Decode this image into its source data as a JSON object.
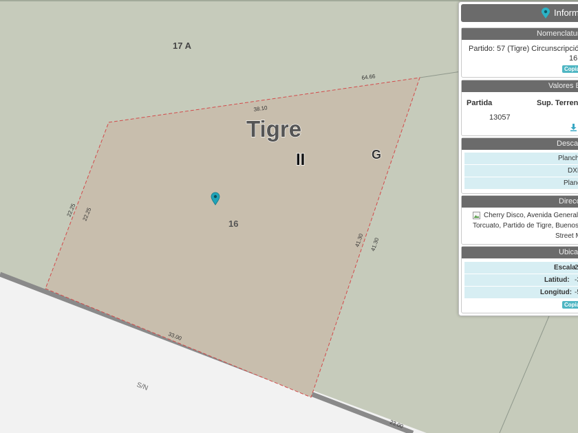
{
  "map": {
    "colors": {
      "land": "#c6cbbb",
      "parcel_fill": "#c8bead",
      "road": "#f2f2f2",
      "boundary": "#d24a4a",
      "road_edge": "#8a8a8a",
      "marker": "#1fa3b8"
    },
    "labels": {
      "block_17a": "17 A",
      "locality": "Tigre",
      "circ": "II",
      "sector": "G",
      "parcel": "16",
      "street": "S/N"
    },
    "dimensions": {
      "d1": "64.66",
      "d2": "38.10",
      "d3": "22.25",
      "d4": "22.25",
      "d5": "41.30",
      "d6": "41.30",
      "d7": "33.00",
      "d8": "23.00"
    }
  },
  "panel": {
    "title": "Inform",
    "nomenclatura": {
      "header": "Nomenclatura",
      "line1": "Partido: 57 (Tigre) Circunscripción: 2",
      "line2": "16",
      "copy": "Copia"
    },
    "valores": {
      "header": "Valores B",
      "col_partida": "Partida",
      "col_sup": "Sup. Terreno",
      "partida_value": "13057"
    },
    "descargas": {
      "header": "Descar",
      "items": [
        "Planch",
        "DXF",
        "Planc"
      ]
    },
    "direccion": {
      "header": "Direcc",
      "line1": "Cherry Disco, Avenida General",
      "line2": "Torcuato, Partido de Tigre, Buenos",
      "line3": "Street M"
    },
    "ubicacion": {
      "header": "Ubicac",
      "escala_label": "Escala:",
      "escala_value": "2",
      "latitud_label": "Latitud:",
      "latitud_value": "-3",
      "longitud_label": "Longitud:",
      "longitud_value": "-5",
      "copy": "Copia"
    }
  }
}
